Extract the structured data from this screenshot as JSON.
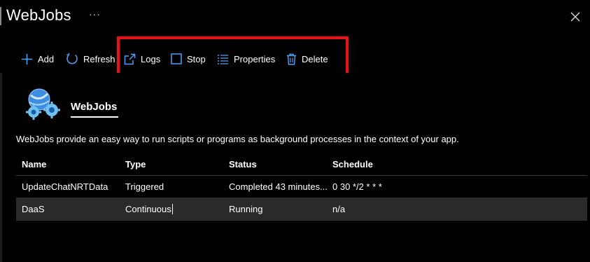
{
  "window": {
    "title": "WebJobs",
    "more_label": "···"
  },
  "toolbar": {
    "add_label": "Add",
    "refresh_label": "Refresh",
    "logs_label": "Logs",
    "stop_label": "Stop",
    "properties_label": "Properties",
    "delete_label": "Delete"
  },
  "section": {
    "title": "WebJobs",
    "description": "WebJobs provide an easy way to run scripts or programs as background processes in the context of your app."
  },
  "table": {
    "headers": [
      "Name",
      "Type",
      "Status",
      "Schedule"
    ],
    "rows": [
      {
        "name": "UpdateChatNRTData",
        "type": "Triggered",
        "status": "Completed 43 minutes...",
        "schedule": "0 30 */2 * * *"
      },
      {
        "name": "DaaS",
        "type": "Continuous",
        "status": "Running",
        "schedule": "n/a"
      }
    ]
  },
  "colors": {
    "background": "#000000",
    "accent_icon": "#4fa3f7",
    "highlight_box": "#e0141c",
    "selected_row": "#2a2a2a"
  },
  "icons": [
    "close-icon",
    "add-icon",
    "refresh-icon",
    "logs-icon",
    "stop-icon",
    "properties-icon",
    "delete-icon",
    "webjobs-icon"
  ]
}
